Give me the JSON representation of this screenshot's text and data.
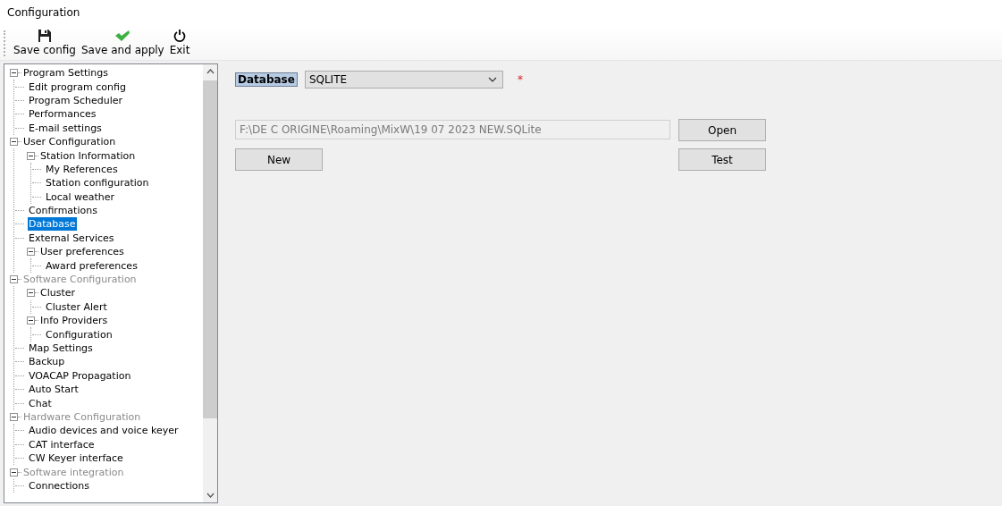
{
  "window": {
    "title": "Configuration"
  },
  "toolbar": [
    {
      "kind": "save",
      "label": "Save config"
    },
    {
      "kind": "apply",
      "label": "Save and apply"
    },
    {
      "kind": "exit",
      "label": "Exit"
    }
  ],
  "tree": [
    {
      "label": "Program Settings",
      "expanded": true,
      "selected": false,
      "disabled": false,
      "children": [
        {
          "label": "Edit program config",
          "selected": false,
          "disabled": false
        },
        {
          "label": "Program Scheduler",
          "selected": false,
          "disabled": false
        },
        {
          "label": "Performances",
          "selected": false,
          "disabled": false
        },
        {
          "label": "E-mail settings",
          "selected": false,
          "disabled": false
        }
      ]
    },
    {
      "label": "User Configuration",
      "expanded": true,
      "selected": false,
      "disabled": false,
      "children": [
        {
          "label": "Station Information",
          "expanded": true,
          "selected": false,
          "disabled": false,
          "children": [
            {
              "label": "My References",
              "selected": false,
              "disabled": false
            },
            {
              "label": "Station configuration",
              "selected": false,
              "disabled": false
            },
            {
              "label": "Local weather",
              "selected": false,
              "disabled": false
            }
          ]
        },
        {
          "label": "Confirmations",
          "selected": false,
          "disabled": false
        },
        {
          "label": "Database",
          "selected": true,
          "disabled": false
        },
        {
          "label": "External Services",
          "selected": false,
          "disabled": false
        },
        {
          "label": "User preferences",
          "expanded": true,
          "selected": false,
          "disabled": false,
          "children": [
            {
              "label": "Award preferences",
              "selected": false,
              "disabled": false
            }
          ]
        }
      ]
    },
    {
      "label": "Software Configuration",
      "expanded": true,
      "selected": false,
      "disabled": true,
      "children": [
        {
          "label": "Cluster",
          "expanded": true,
          "selected": false,
          "disabled": false,
          "children": [
            {
              "label": "Cluster Alert",
              "selected": false,
              "disabled": false
            }
          ]
        },
        {
          "label": "Info Providers",
          "expanded": true,
          "selected": false,
          "disabled": false,
          "children": [
            {
              "label": "Configuration",
              "selected": false,
              "disabled": false
            }
          ]
        },
        {
          "label": "Map Settings",
          "selected": false,
          "disabled": false
        },
        {
          "label": "Backup",
          "selected": false,
          "disabled": false
        },
        {
          "label": "VOACAP Propagation",
          "selected": false,
          "disabled": false
        },
        {
          "label": "Auto Start",
          "selected": false,
          "disabled": false
        },
        {
          "label": "Chat",
          "selected": false,
          "disabled": false
        }
      ]
    },
    {
      "label": "Hardware Configuration",
      "expanded": true,
      "selected": false,
      "disabled": true,
      "children": [
        {
          "label": "Audio devices and voice keyer",
          "selected": false,
          "disabled": false
        },
        {
          "label": "CAT interface",
          "selected": false,
          "disabled": false
        },
        {
          "label": "CW Keyer interface",
          "selected": false,
          "disabled": false
        }
      ]
    },
    {
      "label": "Software integration",
      "expanded": true,
      "selected": false,
      "disabled": true,
      "children": [
        {
          "label": "Connections",
          "selected": false,
          "disabled": false
        }
      ]
    }
  ],
  "database_panel": {
    "label": "Database",
    "engine": "SQLITE",
    "required_mark": "*",
    "file_path": "F:\\DE C ORIGINE\\Roaming\\MixW\\19 07 2023 NEW.SQLite",
    "buttons": {
      "open": "Open",
      "new": "New",
      "test": "Test"
    }
  }
}
